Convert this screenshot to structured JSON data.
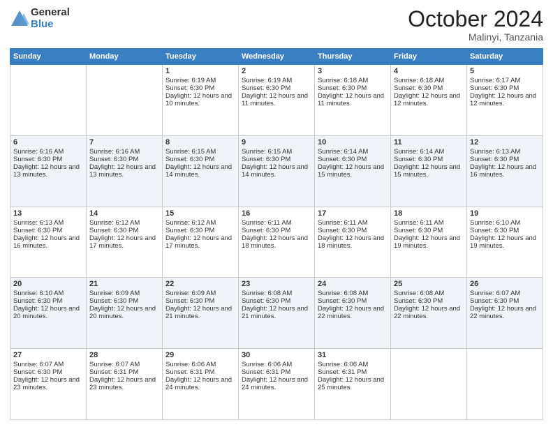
{
  "logo": {
    "general": "General",
    "blue": "Blue"
  },
  "title": "October 2024",
  "location": "Malinyi, Tanzania",
  "days_of_week": [
    "Sunday",
    "Monday",
    "Tuesday",
    "Wednesday",
    "Thursday",
    "Friday",
    "Saturday"
  ],
  "weeks": [
    [
      {
        "day": "",
        "sunrise": "",
        "sunset": "",
        "daylight": ""
      },
      {
        "day": "",
        "sunrise": "",
        "sunset": "",
        "daylight": ""
      },
      {
        "day": "1",
        "sunrise": "Sunrise: 6:19 AM",
        "sunset": "Sunset: 6:30 PM",
        "daylight": "Daylight: 12 hours and 10 minutes."
      },
      {
        "day": "2",
        "sunrise": "Sunrise: 6:19 AM",
        "sunset": "Sunset: 6:30 PM",
        "daylight": "Daylight: 12 hours and 11 minutes."
      },
      {
        "day": "3",
        "sunrise": "Sunrise: 6:18 AM",
        "sunset": "Sunset: 6:30 PM",
        "daylight": "Daylight: 12 hours and 11 minutes."
      },
      {
        "day": "4",
        "sunrise": "Sunrise: 6:18 AM",
        "sunset": "Sunset: 6:30 PM",
        "daylight": "Daylight: 12 hours and 12 minutes."
      },
      {
        "day": "5",
        "sunrise": "Sunrise: 6:17 AM",
        "sunset": "Sunset: 6:30 PM",
        "daylight": "Daylight: 12 hours and 12 minutes."
      }
    ],
    [
      {
        "day": "6",
        "sunrise": "Sunrise: 6:16 AM",
        "sunset": "Sunset: 6:30 PM",
        "daylight": "Daylight: 12 hours and 13 minutes."
      },
      {
        "day": "7",
        "sunrise": "Sunrise: 6:16 AM",
        "sunset": "Sunset: 6:30 PM",
        "daylight": "Daylight: 12 hours and 13 minutes."
      },
      {
        "day": "8",
        "sunrise": "Sunrise: 6:15 AM",
        "sunset": "Sunset: 6:30 PM",
        "daylight": "Daylight: 12 hours and 14 minutes."
      },
      {
        "day": "9",
        "sunrise": "Sunrise: 6:15 AM",
        "sunset": "Sunset: 6:30 PM",
        "daylight": "Daylight: 12 hours and 14 minutes."
      },
      {
        "day": "10",
        "sunrise": "Sunrise: 6:14 AM",
        "sunset": "Sunset: 6:30 PM",
        "daylight": "Daylight: 12 hours and 15 minutes."
      },
      {
        "day": "11",
        "sunrise": "Sunrise: 6:14 AM",
        "sunset": "Sunset: 6:30 PM",
        "daylight": "Daylight: 12 hours and 15 minutes."
      },
      {
        "day": "12",
        "sunrise": "Sunrise: 6:13 AM",
        "sunset": "Sunset: 6:30 PM",
        "daylight": "Daylight: 12 hours and 16 minutes."
      }
    ],
    [
      {
        "day": "13",
        "sunrise": "Sunrise: 6:13 AM",
        "sunset": "Sunset: 6:30 PM",
        "daylight": "Daylight: 12 hours and 16 minutes."
      },
      {
        "day": "14",
        "sunrise": "Sunrise: 6:12 AM",
        "sunset": "Sunset: 6:30 PM",
        "daylight": "Daylight: 12 hours and 17 minutes."
      },
      {
        "day": "15",
        "sunrise": "Sunrise: 6:12 AM",
        "sunset": "Sunset: 6:30 PM",
        "daylight": "Daylight: 12 hours and 17 minutes."
      },
      {
        "day": "16",
        "sunrise": "Sunrise: 6:11 AM",
        "sunset": "Sunset: 6:30 PM",
        "daylight": "Daylight: 12 hours and 18 minutes."
      },
      {
        "day": "17",
        "sunrise": "Sunrise: 6:11 AM",
        "sunset": "Sunset: 6:30 PM",
        "daylight": "Daylight: 12 hours and 18 minutes."
      },
      {
        "day": "18",
        "sunrise": "Sunrise: 6:11 AM",
        "sunset": "Sunset: 6:30 PM",
        "daylight": "Daylight: 12 hours and 19 minutes."
      },
      {
        "day": "19",
        "sunrise": "Sunrise: 6:10 AM",
        "sunset": "Sunset: 6:30 PM",
        "daylight": "Daylight: 12 hours and 19 minutes."
      }
    ],
    [
      {
        "day": "20",
        "sunrise": "Sunrise: 6:10 AM",
        "sunset": "Sunset: 6:30 PM",
        "daylight": "Daylight: 12 hours and 20 minutes."
      },
      {
        "day": "21",
        "sunrise": "Sunrise: 6:09 AM",
        "sunset": "Sunset: 6:30 PM",
        "daylight": "Daylight: 12 hours and 20 minutes."
      },
      {
        "day": "22",
        "sunrise": "Sunrise: 6:09 AM",
        "sunset": "Sunset: 6:30 PM",
        "daylight": "Daylight: 12 hours and 21 minutes."
      },
      {
        "day": "23",
        "sunrise": "Sunrise: 6:08 AM",
        "sunset": "Sunset: 6:30 PM",
        "daylight": "Daylight: 12 hours and 21 minutes."
      },
      {
        "day": "24",
        "sunrise": "Sunrise: 6:08 AM",
        "sunset": "Sunset: 6:30 PM",
        "daylight": "Daylight: 12 hours and 22 minutes."
      },
      {
        "day": "25",
        "sunrise": "Sunrise: 6:08 AM",
        "sunset": "Sunset: 6:30 PM",
        "daylight": "Daylight: 12 hours and 22 minutes."
      },
      {
        "day": "26",
        "sunrise": "Sunrise: 6:07 AM",
        "sunset": "Sunset: 6:30 PM",
        "daylight": "Daylight: 12 hours and 22 minutes."
      }
    ],
    [
      {
        "day": "27",
        "sunrise": "Sunrise: 6:07 AM",
        "sunset": "Sunset: 6:30 PM",
        "daylight": "Daylight: 12 hours and 23 minutes."
      },
      {
        "day": "28",
        "sunrise": "Sunrise: 6:07 AM",
        "sunset": "Sunset: 6:31 PM",
        "daylight": "Daylight: 12 hours and 23 minutes."
      },
      {
        "day": "29",
        "sunrise": "Sunrise: 6:06 AM",
        "sunset": "Sunset: 6:31 PM",
        "daylight": "Daylight: 12 hours and 24 minutes."
      },
      {
        "day": "30",
        "sunrise": "Sunrise: 6:06 AM",
        "sunset": "Sunset: 6:31 PM",
        "daylight": "Daylight: 12 hours and 24 minutes."
      },
      {
        "day": "31",
        "sunrise": "Sunrise: 6:06 AM",
        "sunset": "Sunset: 6:31 PM",
        "daylight": "Daylight: 12 hours and 25 minutes."
      },
      {
        "day": "",
        "sunrise": "",
        "sunset": "",
        "daylight": ""
      },
      {
        "day": "",
        "sunrise": "",
        "sunset": "",
        "daylight": ""
      }
    ]
  ]
}
